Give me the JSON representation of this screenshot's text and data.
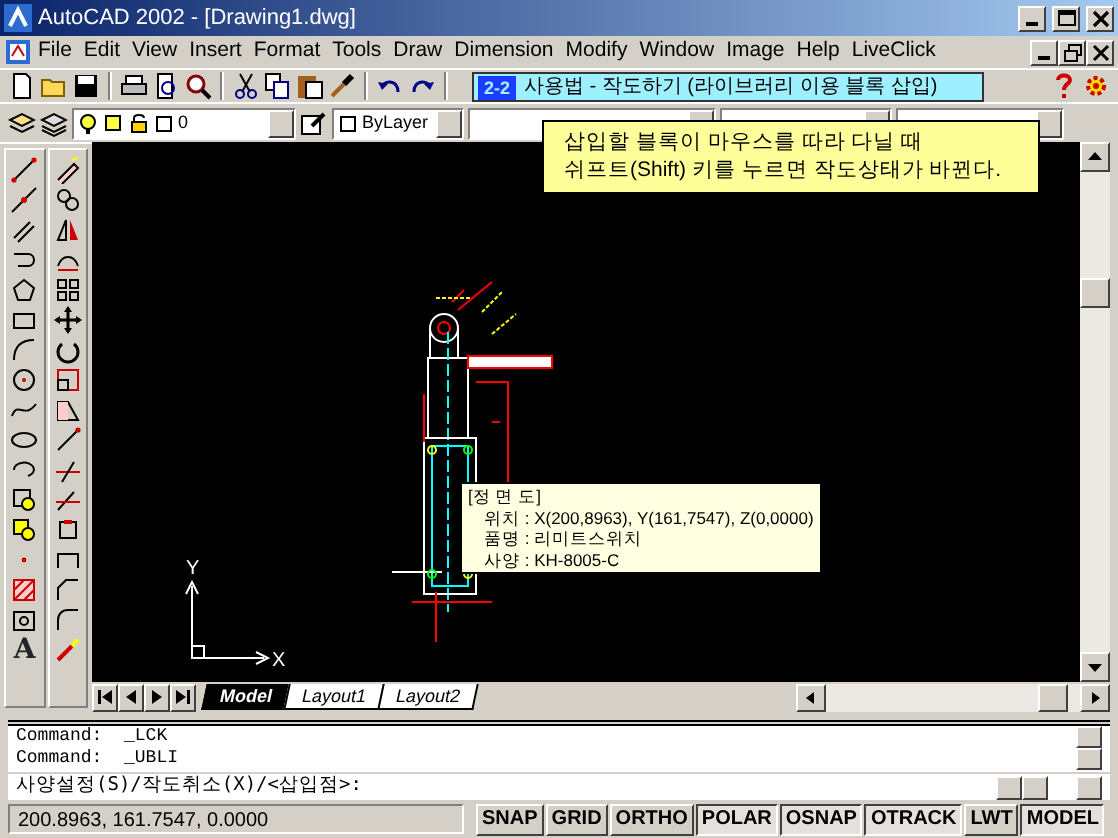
{
  "window": {
    "title": "AutoCAD 2002 - [Drawing1.dwg]"
  },
  "menu": [
    "File",
    "Edit",
    "View",
    "Insert",
    "Format",
    "Tools",
    "Draw",
    "Dimension",
    "Modify",
    "Window",
    "Image",
    "Help",
    "LiveClick"
  ],
  "tutorial_banner": {
    "step": "2-2",
    "title": "사용법 - 작도하기 (라이브러리 이용 블록 삽입)"
  },
  "layer_combo": {
    "value": "0"
  },
  "color_combo": {
    "value": "ByLayer"
  },
  "note": {
    "lines": [
      "삽입할 블록이 마우스를 따라 다닐 때",
      "쉬프트(Shift) 키를 누르면 작도상태가 바뀐다."
    ]
  },
  "drawing": {
    "tooltip": {
      "title": "[정 면 도]",
      "lines": [
        "위치 : X(200,8963), Y(161,7547), Z(0,0000)",
        "품명 : 리미트스위치",
        "사양 : KH-8005-C"
      ]
    },
    "ucs": {
      "x_label": "X",
      "y_label": "Y"
    }
  },
  "draw_toolbar": {
    "text_glyph": "A"
  },
  "layout_tabs": [
    {
      "label": "Model",
      "selected": true
    },
    {
      "label": "Layout1",
      "selected": false
    },
    {
      "label": "Layout2",
      "selected": false
    }
  ],
  "command_lines": [
    "Command:  _LCK",
    "Command:  _UBLI"
  ],
  "command_prompt": "사양설정(S)/작도취소(X)/<삽입점>:",
  "status": {
    "coordinates": "200.8963, 161.7547, 0.0000",
    "toggles": [
      {
        "label": "SNAP",
        "on": false
      },
      {
        "label": "GRID",
        "on": false
      },
      {
        "label": "ORTHO",
        "on": false
      },
      {
        "label": "POLAR",
        "on": true
      },
      {
        "label": "OSNAP",
        "on": true
      },
      {
        "label": "OTRACK",
        "on": true
      },
      {
        "label": "LWT",
        "on": false
      },
      {
        "label": "MODEL",
        "on": true
      }
    ]
  }
}
